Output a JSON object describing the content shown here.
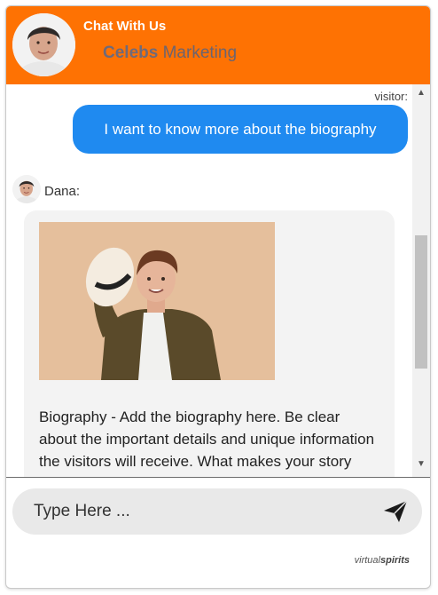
{
  "header": {
    "title": "Chat With Us",
    "brand_bold": "Celebs",
    "brand_rest": " Marketing",
    "background": "#fe7203"
  },
  "messages": {
    "visitor_label": "visitor:",
    "visitor_text": "I want to know more about the biography",
    "agent_name": "Dana:",
    "agent_text": "Biography - Add the biography here. Be clear about the important details and unique information the visitors will receive. What makes your story stand out from the others?"
  },
  "input": {
    "placeholder": "Type Here ..."
  },
  "footer": {
    "brand_light": "virtual",
    "brand_bold": "spirits"
  },
  "colors": {
    "accent": "#fe7203",
    "visitor_bubble": "#1f8af0",
    "agent_bubble": "#f3f3f3"
  },
  "icons": [
    "agent-avatar",
    "send-icon",
    "scroll-up-arrow-icon",
    "scroll-down-arrow-icon"
  ]
}
